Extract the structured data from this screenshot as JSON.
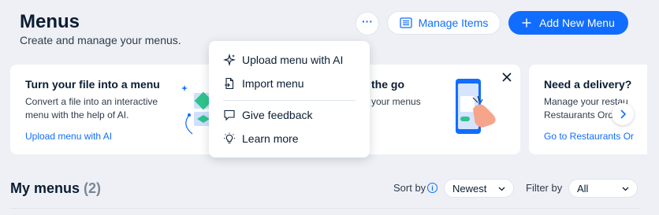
{
  "header": {
    "title": "Menus",
    "subtitle": "Create and manage your menus."
  },
  "toolbar": {
    "more_label": "···",
    "manage_items_label": "Manage Items",
    "add_new_menu_label": "Add New Menu"
  },
  "popup_menu": {
    "items": [
      {
        "label": "Upload menu with AI",
        "icon": "sparkle-icon"
      },
      {
        "label": "Import menu",
        "icon": "file-import-icon"
      },
      {
        "label": "Give feedback",
        "icon": "chat-bubble-icon"
      },
      {
        "label": "Learn more",
        "icon": "lightbulb-icon"
      }
    ]
  },
  "cards": [
    {
      "title": "Turn your file into a menu",
      "text_lines": [
        "Convert a file into an interactive",
        "menu with the help of AI."
      ],
      "link": "Upload menu with AI"
    },
    {
      "title_partial": "the go",
      "text_partial": "your menus"
    },
    {
      "title": "Need a delivery?",
      "text_lines": [
        "Manage your restau",
        "Restaurants Ord"
      ],
      "link": "Go to Restaurants Or"
    }
  ],
  "list": {
    "title": "My menus",
    "count": "(2)",
    "sort_label": "Sort by",
    "sort_value": "Newest",
    "filter_label": "Filter by",
    "filter_value": "All"
  },
  "colors": {
    "accent": "#116dff",
    "background": "#eef0f5",
    "card": "#ffffff",
    "text": "#0b1d33"
  }
}
